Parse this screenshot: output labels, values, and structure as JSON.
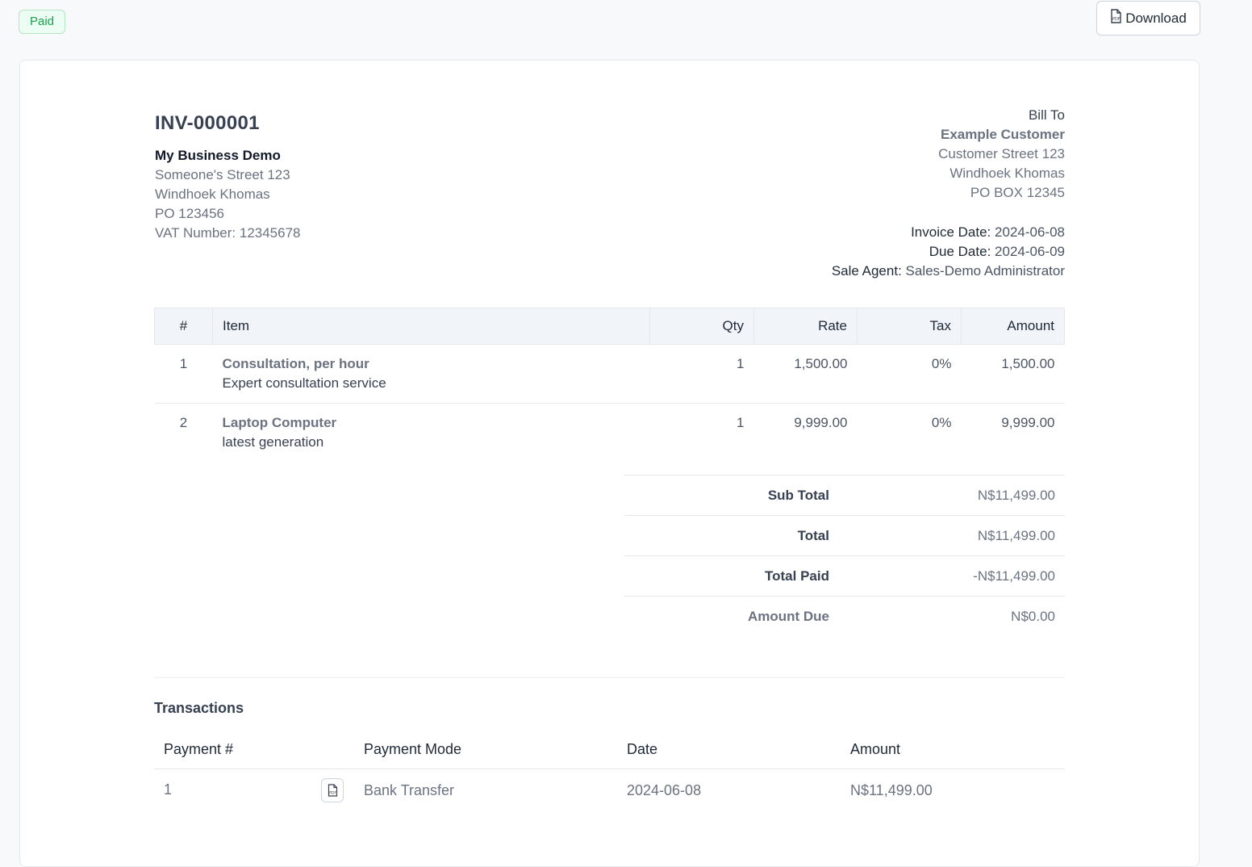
{
  "status": "Paid",
  "download_label": "Download",
  "invoice": {
    "number": "INV-000001",
    "from": {
      "name": "My Business Demo",
      "street": "Someone's Street 123",
      "city": "Windhoek Khomas",
      "po": "PO 123456",
      "vat": "VAT Number: 12345678"
    },
    "bill_to": {
      "label": "Bill To",
      "name": "Example Customer",
      "street": "Customer Street 123",
      "city": "Windhoek Khomas",
      "po": "PO BOX 12345"
    },
    "meta": {
      "invoice_date_label": "Invoice Date:",
      "invoice_date": "2024-06-08",
      "due_date_label": "Due Date:",
      "due_date": "2024-06-09",
      "agent_label": "Sale Agent:",
      "agent": "Sales-Demo Administrator"
    }
  },
  "items_table": {
    "headers": [
      "#",
      "Item",
      "Qty",
      "Rate",
      "Tax",
      "Amount"
    ],
    "rows": [
      {
        "num": "1",
        "name": "Consultation, per hour",
        "desc": "Expert consultation service",
        "qty": "1",
        "rate": "1,500.00",
        "tax": "0%",
        "amount": "1,500.00"
      },
      {
        "num": "2",
        "name": "Laptop Computer",
        "desc": "latest generation",
        "qty": "1",
        "rate": "9,999.00",
        "tax": "0%",
        "amount": "9,999.00"
      }
    ]
  },
  "totals": [
    {
      "label": "Sub Total",
      "value": "N$11,499.00"
    },
    {
      "label": "Total",
      "value": "N$11,499.00"
    },
    {
      "label": "Total Paid",
      "value": "-N$11,499.00"
    },
    {
      "label": "Amount Due",
      "value": "N$0.00"
    }
  ],
  "transactions": {
    "title": "Transactions",
    "headers": [
      "Payment #",
      "Payment Mode",
      "Date",
      "Amount"
    ],
    "rows": [
      {
        "payment_num": "1",
        "mode": "Bank Transfer",
        "date": "2024-06-08",
        "amount": "N$11,499.00"
      }
    ]
  },
  "icons": {
    "download": "pdf-file-icon",
    "payment_pdf": "pdf-file-icon"
  }
}
